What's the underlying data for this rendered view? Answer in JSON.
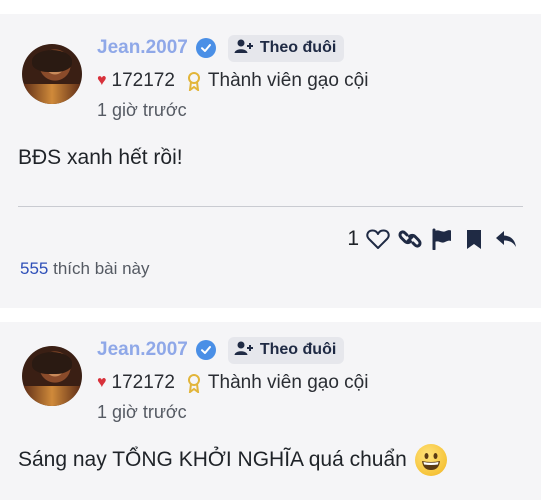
{
  "posts": [
    {
      "username": "Jean.2007",
      "follow_label": "Theo đuôi",
      "heart_score": "172172",
      "rank": "Thành viên gạo cội",
      "time": "1 giờ trước",
      "content": "BĐS xanh hết rồi!",
      "like_count": "1",
      "likes_number": "555",
      "likes_text": "thích bài này"
    },
    {
      "username": "Jean.2007",
      "follow_label": "Theo đuôi",
      "heart_score": "172172",
      "rank": "Thành viên gạo cội",
      "time": "1 giờ trước",
      "content": "Sáng nay TỔNG KHỞI NGHĨA quá chuẩn",
      "emoji": "grinning-face-emoji"
    }
  ],
  "colors": {
    "username": "#8fa8e8",
    "verified": "#4a8fe6",
    "heart": "#d8313b",
    "likes_number": "#2e4fb8",
    "medal": "#e2b53a"
  },
  "icons": [
    "verified-badge-icon",
    "add-user-icon",
    "heart-icon",
    "medal-icon",
    "like-heart-icon",
    "link-icon",
    "flag-icon",
    "bookmark-icon",
    "reply-icon"
  ]
}
